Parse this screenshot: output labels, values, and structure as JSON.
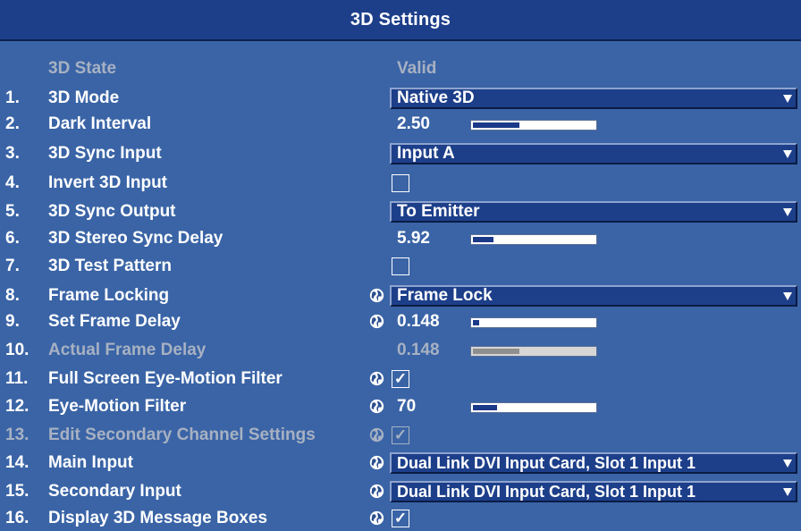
{
  "title": "3D Settings",
  "state_header": {
    "label": "3D State",
    "value": "Valid"
  },
  "items": [
    {
      "num": "1.",
      "label": "3D Mode",
      "control": "dropdown",
      "value": "Native 3D"
    },
    {
      "num": "2.",
      "label": "Dark Interval",
      "control": "slider",
      "value": "2.50",
      "level": 0.38
    },
    {
      "num": "3.",
      "label": "3D Sync Input",
      "control": "dropdown",
      "value": "Input A"
    },
    {
      "num": "4.",
      "label": "Invert 3D Input",
      "control": "checkbox",
      "checked": false
    },
    {
      "num": "5.",
      "label": "3D Sync Output",
      "control": "dropdown",
      "value": "To Emitter"
    },
    {
      "num": "6.",
      "label": "3D Stereo Sync Delay",
      "control": "slider",
      "value": "5.92",
      "level": 0.17
    },
    {
      "num": "7.",
      "label": "3D Test Pattern",
      "control": "checkbox",
      "checked": false
    },
    {
      "num": "8.",
      "label": "Frame Locking",
      "control": "dropdown",
      "value": "Frame Lock",
      "globe": true
    },
    {
      "num": "9.",
      "label": "Set Frame Delay",
      "control": "slider",
      "value": "0.148",
      "level": 0.05,
      "globe": true
    },
    {
      "num": "10.",
      "label": "Actual Frame Delay",
      "control": "slider",
      "value": "0.148",
      "level": 0.38,
      "disabled": true
    },
    {
      "num": "11.",
      "label": "Full Screen Eye-Motion Filter",
      "control": "checkbox",
      "checked": true,
      "globe": true
    },
    {
      "num": "12.",
      "label": "Eye-Motion Filter",
      "control": "slider",
      "value": "70",
      "level": 0.2,
      "globe": true
    },
    {
      "num": "13.",
      "label": "Edit Secondary Channel Settings",
      "control": "checkbox",
      "checked": true,
      "globe": true,
      "disabled": true
    },
    {
      "num": "14.",
      "label": "Main Input",
      "control": "dropdown",
      "value": "Dual Link DVI Input Card, Slot 1 Input 1",
      "globe": true
    },
    {
      "num": "15.",
      "label": "Secondary Input",
      "control": "dropdown",
      "value": "Dual Link DVI Input Card, Slot 1 Input 1",
      "globe": true
    },
    {
      "num": "16.",
      "label": "Display 3D Message Boxes",
      "control": "checkbox",
      "checked": true,
      "globe": true
    }
  ],
  "icons": {
    "globe": "globe-icon",
    "check": "checkmark-icon",
    "arrow": "dropdown-arrow-icon"
  },
  "colors": {
    "background": "#3a64a6",
    "title_bar": "#1d3f8a",
    "disabled_text": "#a7b1c2",
    "slider_fill": "#1a3988"
  },
  "glyphs": {
    "check": "✓"
  }
}
